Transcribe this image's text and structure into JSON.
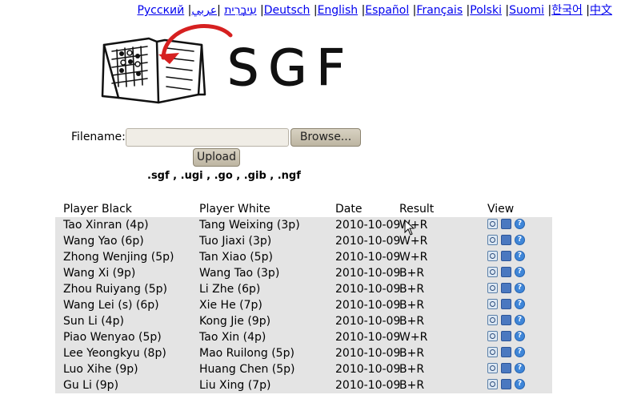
{
  "languages": [
    "Русский",
    "עִיבְרִית",
    "عربي",
    "Deutsch",
    "English",
    "Español",
    "Français",
    "Polski",
    "Suomi",
    "한국어",
    "中文"
  ],
  "logo": {
    "text": "SGF"
  },
  "upload_form": {
    "filename_label": "Filename:",
    "browse_label": "Browse...",
    "upload_label": "Upload",
    "extensions": ".sgf , .ugi , .go , .gib , .ngf"
  },
  "table": {
    "headers": {
      "black": "Player Black",
      "white": "Player White",
      "date": "Date",
      "result": "Result",
      "view": "View"
    },
    "rows": [
      {
        "black": "Tao Xinran (4p)",
        "white": "Tang Weixing (3p)",
        "date": "2010-10-09",
        "result": "W+R"
      },
      {
        "black": "Wang Yao (6p)",
        "white": "Tuo Jiaxi (3p)",
        "date": "2010-10-09",
        "result": "W+R"
      },
      {
        "black": "Zhong Wenjing (5p)",
        "white": "Tan Xiao (5p)",
        "date": "2010-10-09",
        "result": "W+R"
      },
      {
        "black": "Wang Xi (9p)",
        "white": "Wang Tao (3p)",
        "date": "2010-10-09",
        "result": "B+R"
      },
      {
        "black": "Zhou Ruiyang (5p)",
        "white": "Li Zhe (6p)",
        "date": "2010-10-09",
        "result": "B+R"
      },
      {
        "black": "Wang Lei (s) (6p)",
        "white": "Xie He (7p)",
        "date": "2010-10-09",
        "result": "B+R"
      },
      {
        "black": "Sun Li (4p)",
        "white": "Kong Jie (9p)",
        "date": "2010-10-09",
        "result": "B+R"
      },
      {
        "black": "Piao Wenyao (5p)",
        "white": "Tao Xin (4p)",
        "date": "2010-10-09",
        "result": "W+R"
      },
      {
        "black": "Lee Yeongkyu (8p)",
        "white": "Mao Ruilong (5p)",
        "date": "2010-10-09",
        "result": "B+R"
      },
      {
        "black": "Luo Xihe (9p)",
        "white": "Huang Chen (5p)",
        "date": "2010-10-09",
        "result": "B+R"
      },
      {
        "black": "Gu Li (9p)",
        "white": "Liu Xing (7p)",
        "date": "2010-10-09",
        "result": "B+R"
      }
    ],
    "view_icons": [
      "search-icon",
      "board-icon",
      "help-icon"
    ]
  },
  "colors": {
    "link": "#0000ee",
    "row_bg": "#e4e4e4",
    "button_bg": "#c9c1ae"
  }
}
